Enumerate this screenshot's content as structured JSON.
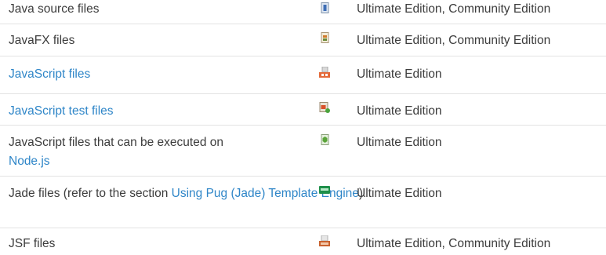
{
  "rows": [
    {
      "name": "Java source files",
      "edition": "Ultimate Edition, Community Edition",
      "icon": "java-file-icon"
    },
    {
      "name": "JavaFX files",
      "edition": "Ultimate Edition, Community Edition",
      "icon": "javafx-file-icon"
    },
    {
      "name": "JavaScript files",
      "edition": "Ultimate Edition",
      "icon": "javascript-file-icon",
      "link": true
    },
    {
      "name": "JavaScript test files",
      "edition": "Ultimate Edition",
      "icon": "javascript-test-file-icon",
      "link": true
    },
    {
      "name_prefix": "JavaScript files that can be executed on",
      "name_link": "Node.js",
      "edition": "Ultimate Edition",
      "icon": "nodejs-file-icon"
    },
    {
      "name_prefix": "Jade files (refer to the section",
      "name_link": "Using Pug (Jade) Template Engine",
      "name_suffix": ").",
      "edition": "Ultimate Edition",
      "icon": "jade-file-icon"
    },
    {
      "name": "JSF files",
      "edition": "Ultimate Edition, Community Edition",
      "icon": "jsf-file-icon"
    }
  ],
  "colors": {
    "link": "#2f86c8",
    "text": "#3c3c3c",
    "divider": "#e3e3e3"
  }
}
